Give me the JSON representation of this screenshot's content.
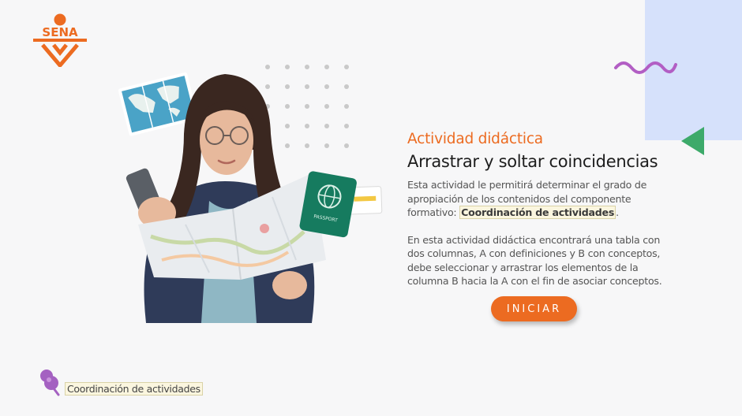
{
  "brand": {
    "logo_text": "SENA",
    "logo_color": "#ec6b21",
    "logo_icon": "sena-figure-icon"
  },
  "decor": {
    "panel_color": "#d6e1fb",
    "wave_color": "#b25ec4",
    "triangle_color": "#3daa6a",
    "dots_color": "#c9c9c9"
  },
  "hero": {
    "illustration": "woman-with-map-photo",
    "passport_text": "PASSPORT"
  },
  "content": {
    "kicker": "Actividad didáctica",
    "title": "Arrastrar y soltar coincidencias",
    "paragraph1_before": "Esta actividad le permitirá determinar el grado de apropiación de los contenidos del componente formativo: ",
    "paragraph1_highlight": "Coordinación de actividades",
    "paragraph1_after": ".",
    "paragraph2": "En esta actividad didáctica encontrará una tabla con dos columnas, A con definiciones y  B con conceptos, debe seleccionar y arrastrar los elementos de la columna  B hacia la A con el fin de asociar conceptos."
  },
  "actions": {
    "start_label": "INICIAR",
    "accent_color": "#ec6b21"
  },
  "footer": {
    "label": "Coordinación de actividades",
    "icon": "pin-icon",
    "pin_color": "#a461c1"
  }
}
